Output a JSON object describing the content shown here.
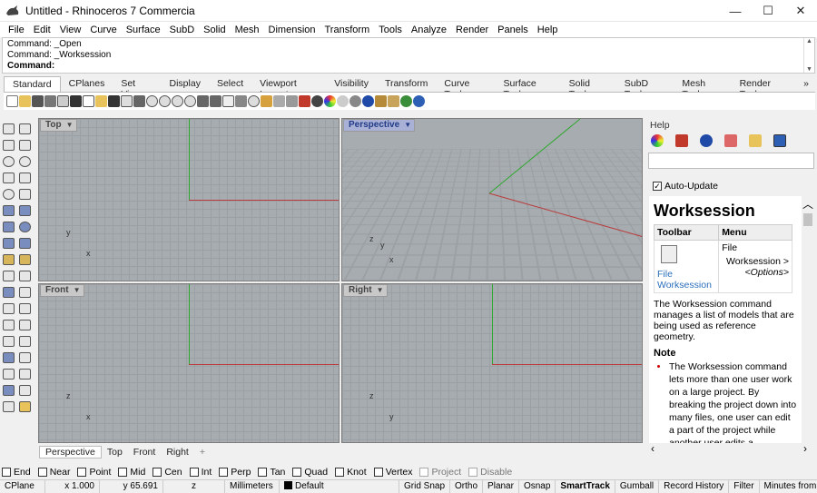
{
  "window": {
    "title": "Untitled - Rhinoceros 7 Commercia",
    "minimize": "—",
    "maximize": "☐",
    "close": "✕"
  },
  "menu": [
    "File",
    "Edit",
    "View",
    "Curve",
    "Surface",
    "SubD",
    "Solid",
    "Mesh",
    "Dimension",
    "Transform",
    "Tools",
    "Analyze",
    "Render",
    "Panels",
    "Help"
  ],
  "command": {
    "line1": "Command: _Open",
    "line2": "Command: _Worksession",
    "prompt": "Command:"
  },
  "tabs": [
    "Standard",
    "CPlanes",
    "Set View",
    "Display",
    "Select",
    "Viewport Layout",
    "Visibility",
    "Transform",
    "Curve Tools",
    "Surface Tools",
    "Solid Tools",
    "SubD Tools",
    "Mesh Tools",
    "Render Tools"
  ],
  "tabs_more": "»",
  "viewports": {
    "top": "Top",
    "perspective": "Perspective",
    "front": "Front",
    "right": "Right"
  },
  "gizmo": {
    "x": "x",
    "y": "y",
    "z": "z"
  },
  "viewport_tabs": [
    "Perspective",
    "Top",
    "Front",
    "Right"
  ],
  "viewport_add": "+",
  "osnaps": [
    {
      "label": "End",
      "checked": false
    },
    {
      "label": "Near",
      "checked": false
    },
    {
      "label": "Point",
      "checked": false
    },
    {
      "label": "Mid",
      "checked": false
    },
    {
      "label": "Cen",
      "checked": false
    },
    {
      "label": "Int",
      "checked": false
    },
    {
      "label": "Perp",
      "checked": false
    },
    {
      "label": "Tan",
      "checked": false
    },
    {
      "label": "Quad",
      "checked": false
    },
    {
      "label": "Knot",
      "checked": false
    },
    {
      "label": "Vertex",
      "checked": false
    },
    {
      "label": "Project",
      "checked": false,
      "disabled": true
    },
    {
      "label": "Disable",
      "checked": false,
      "disabled": true
    }
  ],
  "status": {
    "cplane": "CPlane",
    "x": "x 1.000",
    "y": "y 65.691",
    "z": "z",
    "units": "Millimeters",
    "layer": "Default",
    "gridsnap": "Grid Snap",
    "ortho": "Ortho",
    "planar": "Planar",
    "osnap": "Osnap",
    "smarttrack": "SmartTrack",
    "gumball": "Gumball",
    "record": "Record History",
    "filter": "Filter",
    "minutes": "Minutes from la..."
  },
  "panel": {
    "header": "Help",
    "autoupdate": "Auto-Update",
    "doc_title": "Worksession",
    "col_toolbar": "Toolbar",
    "col_menu": "Menu",
    "toolbar_link_1": "File",
    "toolbar_link_2": "Worksession",
    "menu_1": "File",
    "menu_2": "Worksession >",
    "menu_3": "<Options>",
    "description": "The Worksession command manages a list of models that are being used as reference geometry.",
    "note_heading": "Note",
    "note_text": "The Worksession command lets more than one user work on a large project. By breaking the project down into many files, one user can edit a part of the project while another user edits a"
  }
}
